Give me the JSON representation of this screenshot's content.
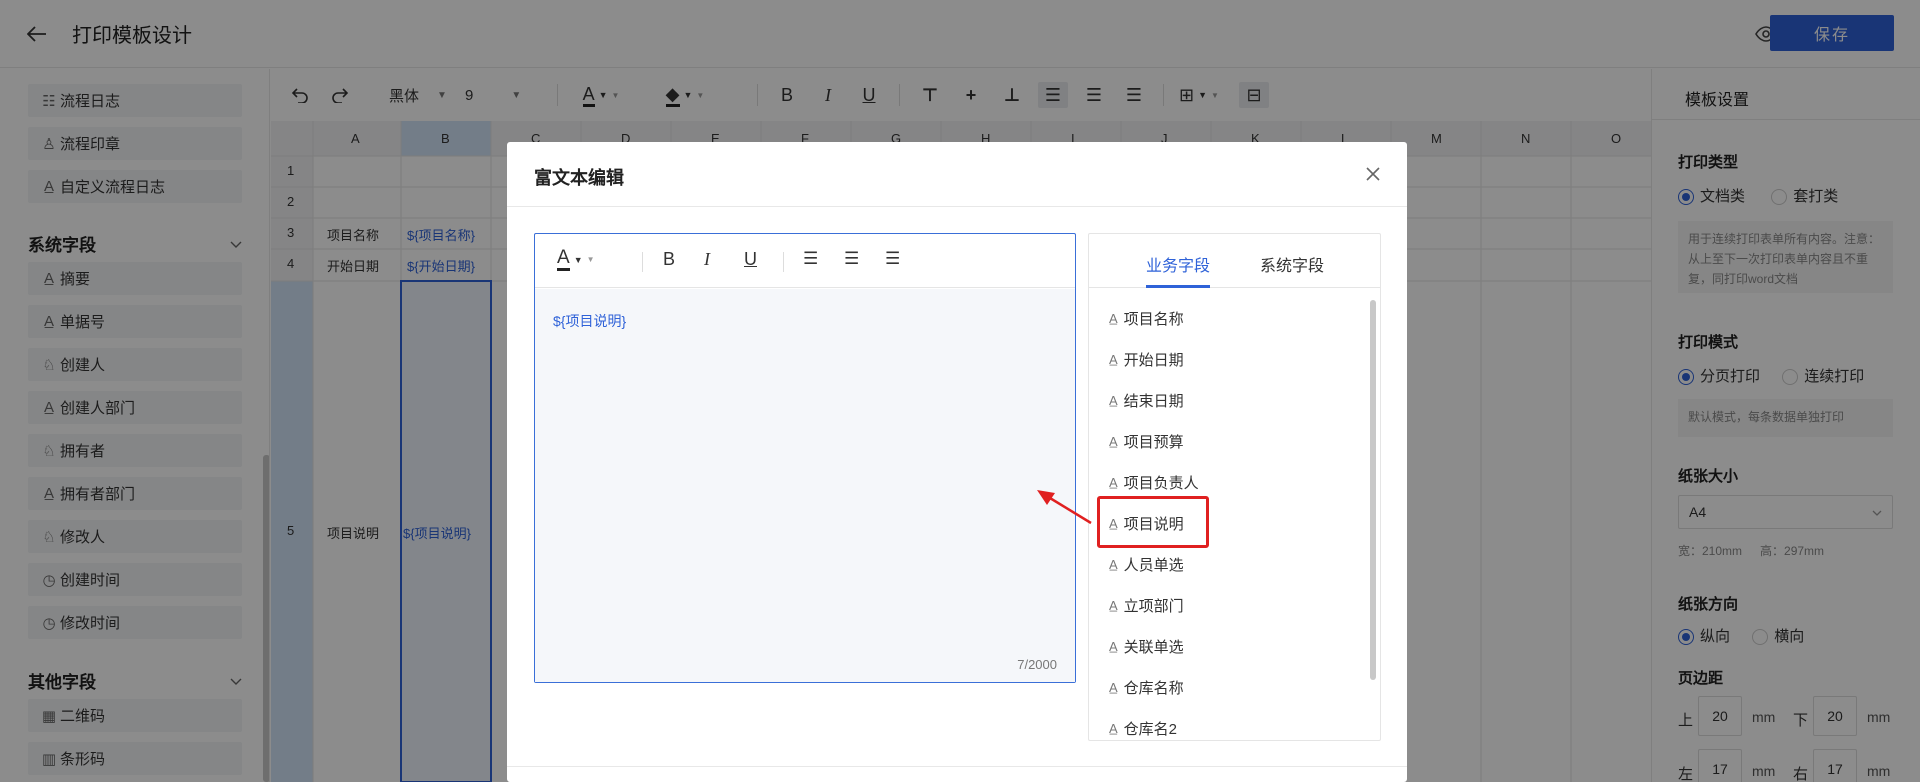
{
  "header": {
    "title": "打印模板设计",
    "save_label": "保存"
  },
  "sidebar": {
    "top_items": [
      {
        "label": "流程日志",
        "icon": "list-icon"
      },
      {
        "label": "流程印章",
        "icon": "stamp-icon"
      },
      {
        "label": "自定义流程日志",
        "icon": "text-icon"
      }
    ],
    "system_section": "系统字段",
    "system_items": [
      {
        "label": "摘要",
        "icon": "text-icon"
      },
      {
        "label": "单据号",
        "icon": "text-icon"
      },
      {
        "label": "创建人",
        "icon": "user-icon"
      },
      {
        "label": "创建人部门",
        "icon": "text-icon"
      },
      {
        "label": "拥有者",
        "icon": "user-icon"
      },
      {
        "label": "拥有者部门",
        "icon": "text-icon"
      },
      {
        "label": "修改人",
        "icon": "user-icon"
      },
      {
        "label": "创建时间",
        "icon": "clock-icon"
      },
      {
        "label": "修改时间",
        "icon": "clock-icon"
      }
    ],
    "other_section": "其他字段",
    "other_items": [
      {
        "label": "二维码",
        "icon": "qrcode-icon"
      },
      {
        "label": "条形码",
        "icon": "barcode-icon"
      }
    ]
  },
  "toolbar": {
    "font": "黑体",
    "size": "9"
  },
  "grid": {
    "columns": [
      "A",
      "B",
      "C",
      "D",
      "E",
      "F",
      "G",
      "H",
      "I",
      "J",
      "K",
      "L",
      "M",
      "N",
      "O"
    ],
    "rows": [
      "1",
      "2",
      "3",
      "4",
      "5"
    ],
    "cells": {
      "a3": "项目名称",
      "b3": "${项目名称}",
      "a4": "开始日期",
      "b4": "${开始日期}",
      "a5": "项目说明",
      "b5": "${项目说明}"
    }
  },
  "right_panel": {
    "title": "模板设置",
    "print_type_label": "打印类型",
    "print_type_options": [
      "文档类",
      "套打类"
    ],
    "print_type_desc": "用于连续打印表单所有内容。注意：从上至下一次打印表单内容且不重复，同打印word文档",
    "print_mode_label": "打印模式",
    "print_mode_options": [
      "分页打印",
      "连续打印"
    ],
    "print_mode_desc": "默认模式，每条数据单独打印",
    "paper_size_label": "纸张大小",
    "paper_size_value": "A4",
    "paper_width": "宽：210mm",
    "paper_height": "高：297mm",
    "orientation_label": "纸张方向",
    "orientation_options": [
      "纵向",
      "横向"
    ],
    "margin_label": "页边距",
    "margin_top_label": "上",
    "margin_top": "20",
    "margin_bottom_label": "下",
    "margin_bottom": "20",
    "margin_left_label": "左",
    "margin_left": "17",
    "margin_right_label": "右",
    "margin_right": "17",
    "unit": "mm"
  },
  "modal": {
    "title": "富文本编辑",
    "content": "${项目说明}",
    "char_count": "7/2000",
    "tabs": [
      "业务字段",
      "系统字段"
    ],
    "fields": [
      "项目名称",
      "开始日期",
      "结束日期",
      "项目预算",
      "项目负责人",
      "项目说明",
      "人员单选",
      "立项部门",
      "关联单选",
      "仓库名称",
      "仓库名2"
    ]
  },
  "colors": {
    "primary": "#2f62d8",
    "highlight": "#e02020"
  }
}
